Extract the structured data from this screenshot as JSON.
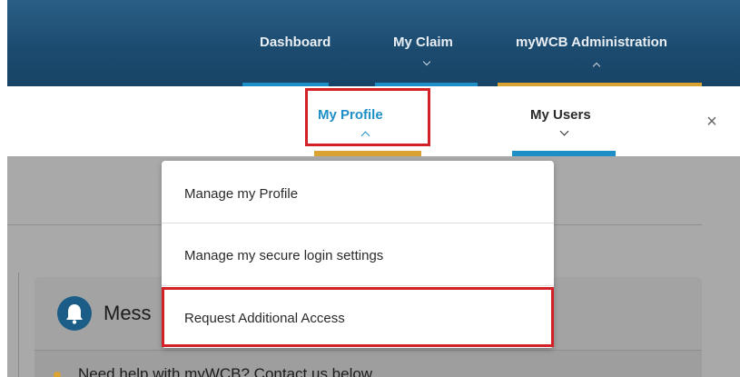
{
  "colors": {
    "topbar": "#1c4b70",
    "active_link": "#1e8fc6",
    "underline_blue": "#1e8fc6",
    "underline_gold": "#d9a233",
    "highlight_red": "#d32128"
  },
  "top_nav": {
    "items": [
      {
        "label": "Dashboard",
        "icon": null
      },
      {
        "label": "My Claim",
        "icon": "chevron-down-icon"
      },
      {
        "label": "myWCB Administration",
        "icon": "chevron-up-icon"
      }
    ]
  },
  "sub_nav": {
    "items": [
      {
        "label": "My Profile",
        "icon": "chevron-up-icon",
        "active": true
      },
      {
        "label": "My Users",
        "icon": "chevron-down-icon",
        "active": false
      }
    ],
    "close_icon": "close-icon",
    "close_glyph": "×"
  },
  "dropdown": {
    "items": [
      {
        "label": "Manage my Profile"
      },
      {
        "label": "Manage my secure login settings"
      },
      {
        "label": "Request Additional Access"
      }
    ]
  },
  "messages_card": {
    "title": "Mess",
    "icon": "bell-icon",
    "help_text": "Need help with myWCB? Contact us below"
  }
}
